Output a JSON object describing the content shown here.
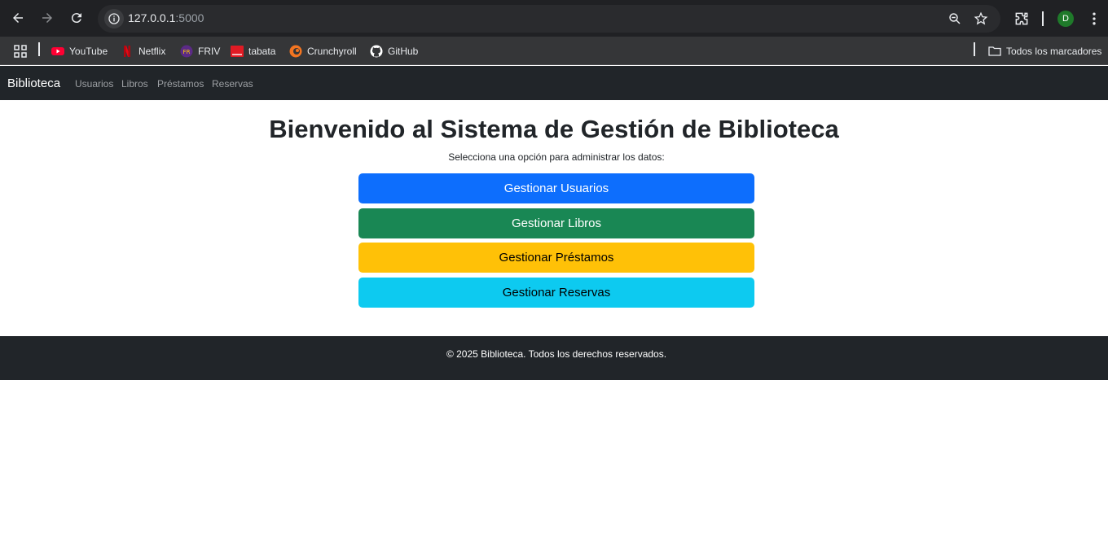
{
  "browser": {
    "url_host": "127.0.0.1",
    "url_port": ":5000",
    "avatar_letter": "D",
    "bookmarks": [
      {
        "label": "YouTube",
        "icon": "youtube-icon"
      },
      {
        "label": "Netflix",
        "icon": "netflix-icon"
      },
      {
        "label": "FRIV",
        "icon": "friv-icon"
      },
      {
        "label": "tabata",
        "icon": "tabata-icon"
      },
      {
        "label": "Crunchyroll",
        "icon": "crunchyroll-icon"
      },
      {
        "label": "GitHub",
        "icon": "github-icon"
      }
    ],
    "all_bookmarks_label": "Todos los marcadores"
  },
  "navbar": {
    "brand": "Biblioteca",
    "links": [
      "Usuarios",
      "Libros",
      "Préstamos",
      "Reservas"
    ]
  },
  "main": {
    "title": "Bienvenido al Sistema de Gestión de Biblioteca",
    "subtitle": "Selecciona una opción para administrar los datos:",
    "buttons": [
      {
        "label": "Gestionar Usuarios",
        "color": "#0d6efd",
        "text_color": "#ffffff"
      },
      {
        "label": "Gestionar Libros",
        "color": "#198754",
        "text_color": "#ffffff"
      },
      {
        "label": "Gestionar Préstamos",
        "color": "#ffc107",
        "text_color": "#000000"
      },
      {
        "label": "Gestionar Reservas",
        "color": "#0dcaf0",
        "text_color": "#000000"
      }
    ]
  },
  "footer": {
    "text": "© 2025 Biblioteca. Todos los derechos reservados."
  },
  "colors": {
    "chrome_bg": "#202124",
    "bookmarks_bg": "#353638",
    "navbar_bg": "#212529"
  }
}
